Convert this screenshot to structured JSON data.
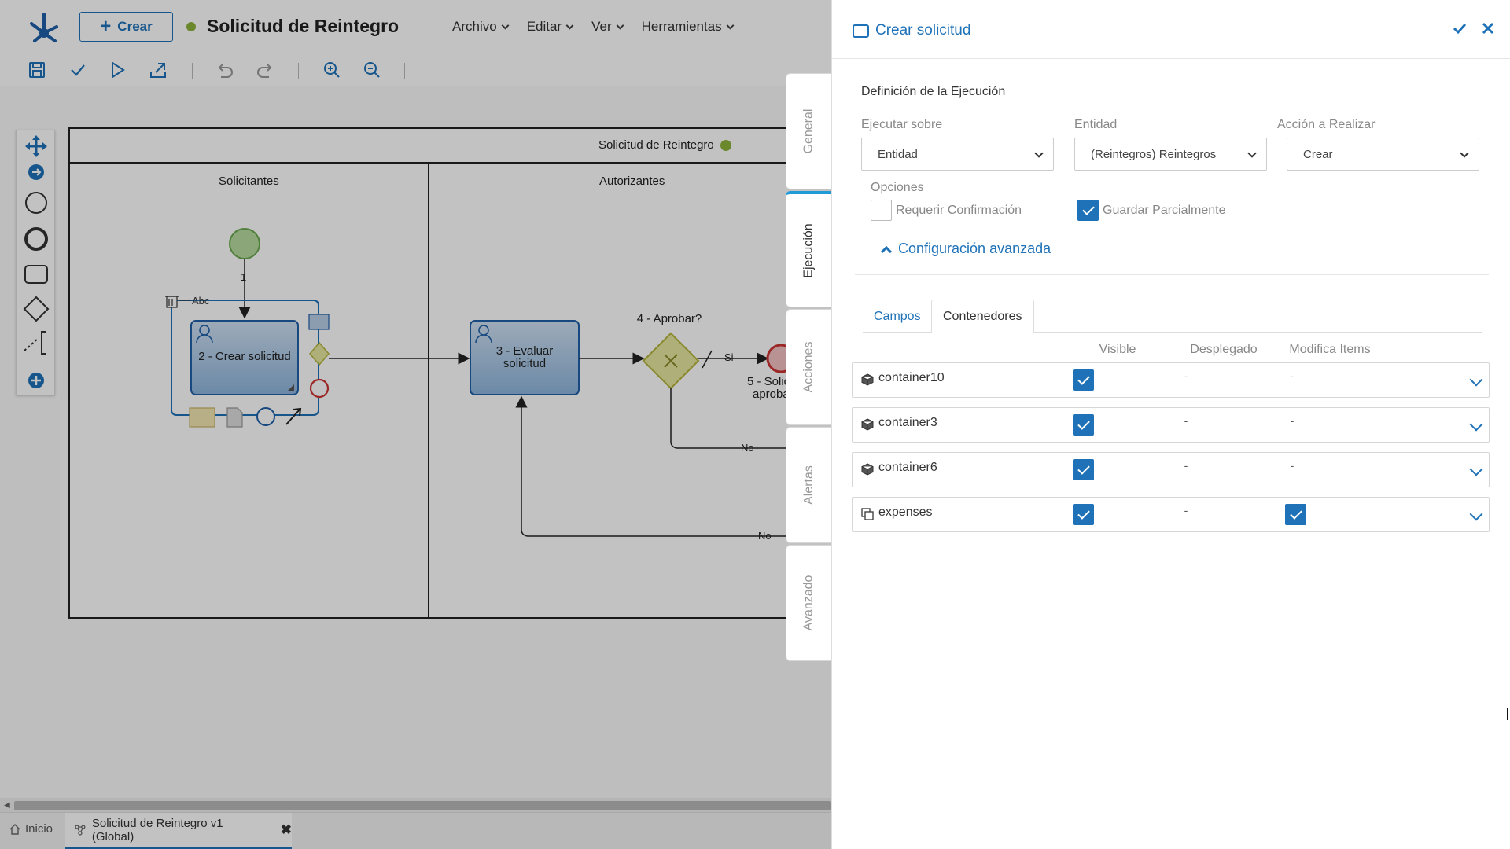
{
  "topbar": {
    "create_label": "Crear",
    "process_title": "Solicitud de Reintegro",
    "menu": [
      "Archivo",
      "Editar",
      "Ver",
      "Herramientas"
    ]
  },
  "diagram": {
    "pool_title": "Solicitud de Reintegro",
    "lanes": [
      "Solicitantes",
      "Autorizantes"
    ],
    "flow_label_1": "1",
    "text_tool_label": "Abc",
    "task_create": "2 - Crear solicitud",
    "task_evaluate": [
      "3 - Evaluar",
      "solicitud"
    ],
    "gateway_label": "4 - Aprobar?",
    "flow_si": "Si",
    "flow_no_1": "No",
    "flow_no_2": "No",
    "end_label": [
      "5 - Solic",
      "aproba"
    ]
  },
  "bottom_tabs": {
    "home": "Inicio",
    "process": "Solicitud de Reintegro v1 (Global)"
  },
  "side_tabs": [
    "General",
    "Ejecución",
    "Acciones",
    "Alertas",
    "Avanzado"
  ],
  "panel": {
    "title": "Crear solicitud",
    "section_title": "Definición de la Ejecución",
    "fields": {
      "ejecutar_label": "Ejecutar sobre",
      "ejecutar_value": "Entidad",
      "entidad_label": "Entidad",
      "entidad_value": "(Reintegros) Reintegros",
      "accion_label": "Acción a Realizar",
      "accion_value": "Crear"
    },
    "options_label": "Opciones",
    "option_confirm": "Requerir Confirmación",
    "option_confirm_checked": false,
    "option_partial": "Guardar Parcialmente",
    "option_partial_checked": true,
    "advanced_toggle": "Configuración avanzada",
    "tabs": [
      "Campos",
      "Contenedores"
    ],
    "active_tab": "Contenedores",
    "columns": [
      "Visible",
      "Desplegado",
      "Modifica Items"
    ],
    "containers": [
      {
        "name": "container10",
        "icon": "cube-icon",
        "visible": true,
        "deployed": "-",
        "modifies": "-"
      },
      {
        "name": "container3",
        "icon": "cube-icon",
        "visible": true,
        "deployed": "-",
        "modifies": "-"
      },
      {
        "name": "container6",
        "icon": "cube-icon",
        "visible": true,
        "deployed": "-",
        "modifies": "-"
      },
      {
        "name": "expenses",
        "icon": "copy-icon",
        "visible": true,
        "deployed": "-",
        "modifies": true
      }
    ]
  },
  "colors": {
    "accent": "#1f72b8",
    "status_green": "#8fb33b",
    "active_tab_border": "#1f9cd8"
  }
}
